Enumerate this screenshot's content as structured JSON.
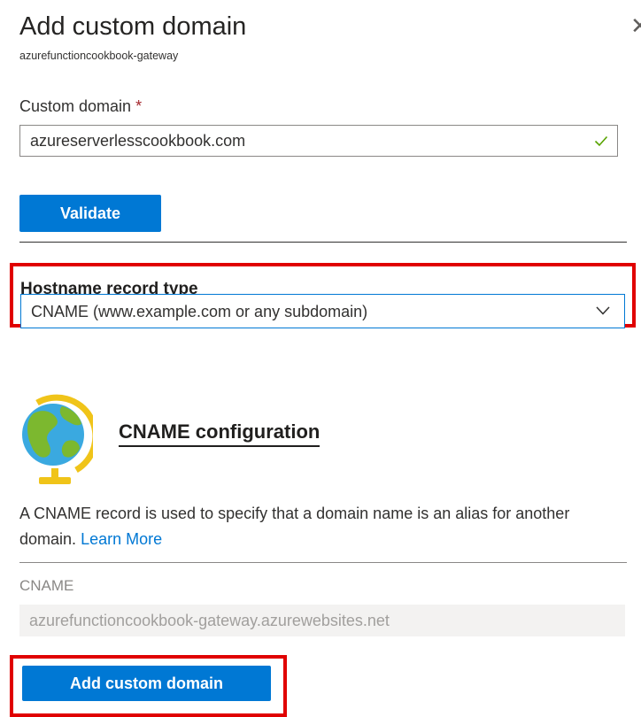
{
  "panel": {
    "title": "Add custom domain",
    "subtitle": "azurefunctioncookbook-gateway",
    "close_glyph": "✕"
  },
  "custom_domain": {
    "label": "Custom domain",
    "required_marker": "*",
    "value": "azureserverlesscookbook.com",
    "status_icon": "check-icon"
  },
  "validate_button": {
    "label": "Validate"
  },
  "hostname": {
    "label": "Hostname record type",
    "selected": "CNAME (www.example.com or any subdomain)"
  },
  "cname_config": {
    "title": "CNAME configuration",
    "description": "A CNAME record is used to specify that a domain name is an alias for another domain.",
    "learn_more": "Learn More",
    "icon": "globe-icon"
  },
  "cname_field": {
    "label": "CNAME",
    "value": "azurefunctioncookbook-gateway.azurewebsites.net"
  },
  "add_button": {
    "label": "Add custom domain"
  },
  "colors": {
    "accent": "#0078d4",
    "highlight": "#e00000"
  }
}
